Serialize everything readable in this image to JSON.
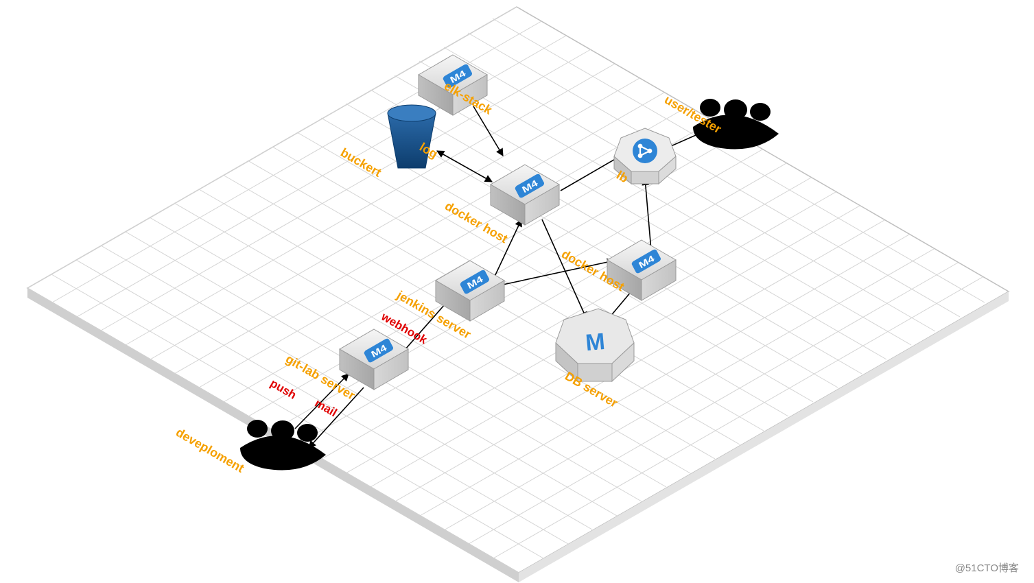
{
  "labels": {
    "elk_stack": "elk-stack",
    "user_tester": "user/tester",
    "buckert": "buckert",
    "log": "log",
    "lb": "lb",
    "docker_host_1": "docker host",
    "docker_host_2": "docker host",
    "jenkins_server": "jenkins server",
    "webhook": "webhook",
    "gitlab_server": "git-lab server",
    "push": "push",
    "mail": "mail",
    "db_server": "DB server",
    "deveploment": "deveploment"
  },
  "node_text": {
    "m4": "M4",
    "db_m": "M"
  },
  "watermark": "@51CTO博客",
  "chart_data": {
    "type": "architecture-topology",
    "nodes": [
      {
        "id": "elk",
        "label": "elk-stack",
        "kind": "server-m4"
      },
      {
        "id": "bucket",
        "label": "buckert",
        "kind": "storage-bucket"
      },
      {
        "id": "dh1",
        "label": "docker host",
        "kind": "server-m4"
      },
      {
        "id": "dh2",
        "label": "docker host",
        "kind": "server-m4"
      },
      {
        "id": "lb",
        "label": "lb",
        "kind": "load-balancer"
      },
      {
        "id": "db",
        "label": "DB server",
        "kind": "database"
      },
      {
        "id": "jenkins",
        "label": "jenkins server",
        "kind": "server-m4"
      },
      {
        "id": "gitlab",
        "label": "git-lab server",
        "kind": "server-m4"
      },
      {
        "id": "users",
        "label": "user/tester",
        "kind": "people"
      },
      {
        "id": "devs",
        "label": "deveploment",
        "kind": "people"
      }
    ],
    "edges": [
      {
        "from": "elk",
        "to": "dh1",
        "label": ""
      },
      {
        "from": "bucket",
        "to": "dh1",
        "label": "log"
      },
      {
        "from": "dh1",
        "to": "lb",
        "label": ""
      },
      {
        "from": "dh2",
        "to": "lb",
        "label": ""
      },
      {
        "from": "users",
        "to": "lb",
        "label": ""
      },
      {
        "from": "dh1",
        "to": "db",
        "label": ""
      },
      {
        "from": "dh2",
        "to": "db",
        "label": ""
      },
      {
        "from": "jenkins",
        "to": "dh1",
        "label": ""
      },
      {
        "from": "jenkins",
        "to": "dh2",
        "label": ""
      },
      {
        "from": "gitlab",
        "to": "jenkins",
        "label": "webhook"
      },
      {
        "from": "devs",
        "to": "gitlab",
        "label": "push"
      },
      {
        "from": "gitlab",
        "to": "devs",
        "label": "mail"
      }
    ]
  }
}
